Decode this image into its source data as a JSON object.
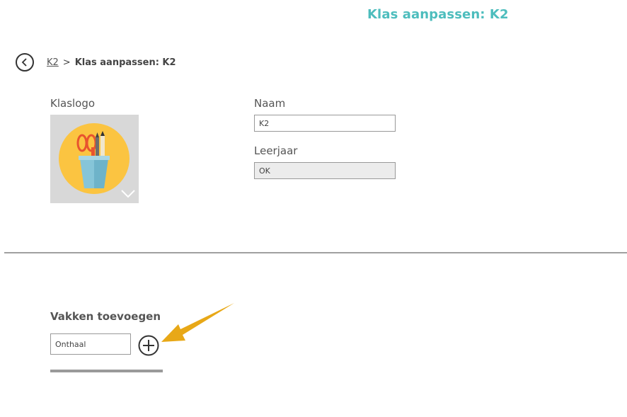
{
  "header": {
    "title": "Klas aanpassen: K2"
  },
  "breadcrumb": {
    "parent": "K2",
    "separator": ">",
    "current": "Klas aanpassen: K2"
  },
  "form": {
    "logo_label": "Klaslogo",
    "name_label": "Naam",
    "name_value": "K2",
    "grade_label": "Leerjaar",
    "grade_value": "OK"
  },
  "subjects": {
    "title": "Vakken toevoegen",
    "input_value": "Onthaal"
  },
  "colors": {
    "accent": "#4dbdbd",
    "arrow": "#e8a817",
    "logo_circle": "#fbc441"
  },
  "icons": [
    "back-arrow-icon",
    "chevron-down-icon",
    "plus-circle-icon",
    "pencil-cup-icon",
    "pointer-arrow-icon"
  ]
}
